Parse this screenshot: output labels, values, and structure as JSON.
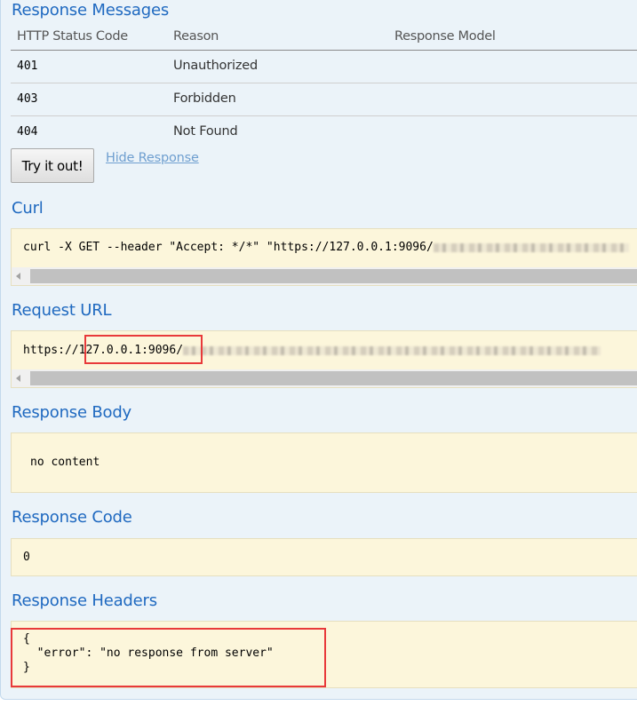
{
  "response_messages": {
    "title": "Response Messages",
    "columns": [
      "HTTP Status Code",
      "Reason",
      "Response Model"
    ],
    "rows": [
      {
        "code": "401",
        "reason": "Unauthorized",
        "model": ""
      },
      {
        "code": "403",
        "reason": "Forbidden",
        "model": ""
      },
      {
        "code": "404",
        "reason": "Not Found",
        "model": ""
      }
    ]
  },
  "actions": {
    "try_button": "Try it out!",
    "hide_link": "Hide Response"
  },
  "curl": {
    "title": "Curl",
    "command_prefix": "curl -X GET --header \"Accept: */*\" \"https://127.0.0.1:9096/",
    "redacted": true
  },
  "request_url": {
    "title": "Request URL",
    "scheme": "https://",
    "host_port": "127.0.0.1:9096",
    "path_separator": "/",
    "redacted": true
  },
  "response_body": {
    "title": "Response Body",
    "value": "no content"
  },
  "response_code": {
    "title": "Response Code",
    "value": "0"
  },
  "response_headers": {
    "title": "Response Headers",
    "lines": [
      "{",
      "  \"error\": \"no response from server\"",
      "}"
    ]
  },
  "colors": {
    "heading": "#1f69c0",
    "panel_bg": "#ebf3f9",
    "code_bg": "#fcf6db",
    "highlight_box": "#e8393a",
    "link": "#6f9fd0"
  }
}
